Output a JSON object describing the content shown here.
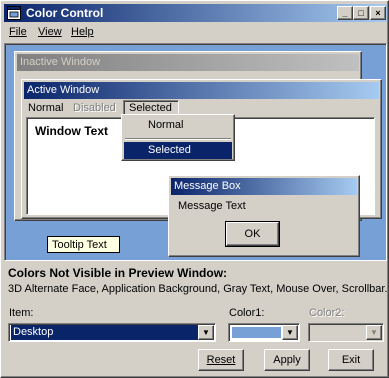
{
  "window": {
    "title": "Color Control",
    "buttons": {
      "minimize": "_",
      "maximize": "□",
      "close": "×"
    }
  },
  "menu": {
    "file": "File",
    "view": "View",
    "help": "Help"
  },
  "preview": {
    "inactive_title": "Inactive Window",
    "active_title": "Active Window",
    "menu_normal": "Normal",
    "menu_disabled": "Disabled",
    "menu_selected": "Selected",
    "window_text": "Window Text",
    "dropdown": {
      "normal": "Normal",
      "selected": "Selected"
    },
    "message_box": {
      "title": "Message Box",
      "text": "Message Text",
      "ok": "OK"
    },
    "tooltip": "Tooltip Text",
    "colors": {
      "desktop": "#77a0d6",
      "active_title_start": "#0a246a",
      "active_title_end": "#a6caf0",
      "inactive_title_start": "#808080",
      "inactive_title_end": "#c0c0c0",
      "face": "#d4d0c8",
      "tooltip_bg": "#ffffe1"
    }
  },
  "not_visible": {
    "title": "Colors Not Visible in Preview Window:",
    "text": "3D Alternate Face, Application Background, Gray Text, Mouse Over, Scrollbar."
  },
  "item": {
    "label": "Item:",
    "value": "Desktop"
  },
  "color1": {
    "label": "Color1:",
    "value": "#77a0d6"
  },
  "color2": {
    "label": "Color2:"
  },
  "actions": {
    "reset": "Reset",
    "apply": "Apply",
    "exit": "Exit"
  }
}
